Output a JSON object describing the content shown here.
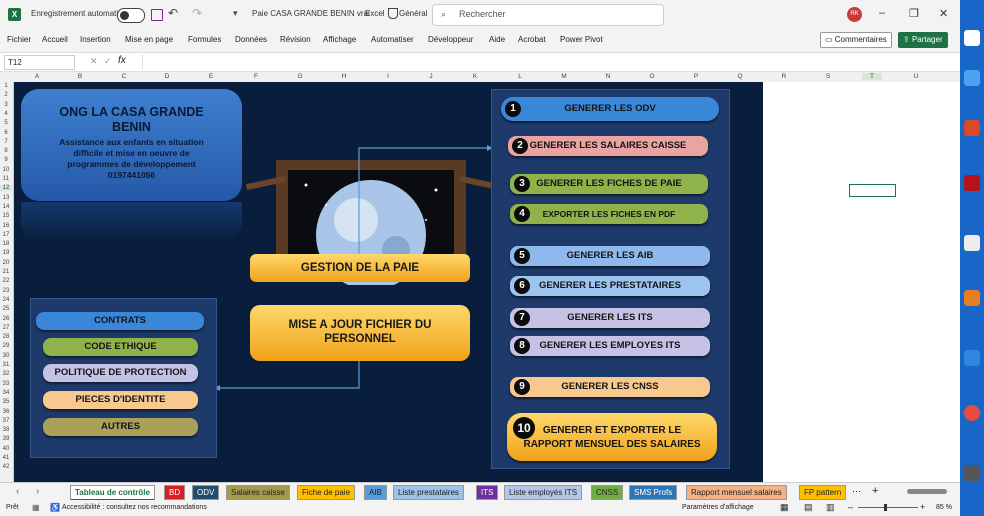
{
  "titlebar": {
    "autosave_label": "Enregistrement automatique",
    "doc_title": "Paie CASA GRANDE BENIN vrai",
    "app_name": "Excel",
    "sensitivity": "Général",
    "search_placeholder": "Rechercher",
    "avatar_initials": "RK"
  },
  "menu": [
    "Fichier",
    "Accueil",
    "Insertion",
    "Mise en page",
    "Formules",
    "Données",
    "Révision",
    "Affichage",
    "Automatiser",
    "Développeur",
    "Aide",
    "Acrobat",
    "Power Pivot"
  ],
  "comments_label": "Commentaires",
  "share_label": "Partager",
  "formula_bar": {
    "name_box": "T12",
    "fx": "fx"
  },
  "columns": [
    "A",
    "B",
    "C",
    "D",
    "E",
    "F",
    "G",
    "H",
    "I",
    "J",
    "K",
    "L",
    "M",
    "N",
    "O",
    "P",
    "Q",
    "R",
    "S",
    "T",
    "U"
  ],
  "rows": [
    "1",
    "2",
    "3",
    "4",
    "5",
    "6",
    "7",
    "8",
    "9",
    "10",
    "11",
    "12",
    "13",
    "14",
    "15",
    "16",
    "17",
    "18",
    "19",
    "20",
    "21",
    "22",
    "23",
    "24",
    "25",
    "26",
    "27",
    "28",
    "29",
    "30",
    "31",
    "32",
    "33",
    "34",
    "35",
    "36",
    "37",
    "38",
    "39",
    "40",
    "41",
    "42"
  ],
  "dashboard": {
    "org_name_1": "ONG LA CASA GRANDE",
    "org_name_2": "BENIN",
    "org_desc_1": "Assistance aux enfants en situation",
    "org_desc_2": "difficile et mise en oeuvre de",
    "org_desc_3": "programmes de développement",
    "org_phone": "0197441056",
    "gestion": "GESTION DE LA PAIE",
    "mise_a_jour_1": "MISE A JOUR FICHIER DU",
    "mise_a_jour_2": "PERSONNEL",
    "left_buttons": [
      {
        "label": "CONTRATS",
        "color": "#3a86d8"
      },
      {
        "label": "CODE ETHIQUE",
        "color": "#8fb34a"
      },
      {
        "label": "POLITIQUE DE PROTECTION",
        "color": "#c6c2e6"
      },
      {
        "label": "PIECES D'IDENTITE",
        "color": "#f7c98f"
      },
      {
        "label": "AUTRES",
        "color": "#a9a15a"
      }
    ],
    "right_buttons": [
      {
        "num": "1",
        "label": "GENERER LES ODV",
        "color": "#3a86d8"
      },
      {
        "num": "2",
        "label": "GENERER LES SALAIRES CAISSE",
        "color": "#e9a3a0"
      },
      {
        "num": "3",
        "label": "GENERER LES FICHES DE PAIE",
        "color": "#8fb34a"
      },
      {
        "num": "4",
        "label": "EXPORTER LES FICHES EN PDF",
        "color": "#8fb34a"
      },
      {
        "num": "5",
        "label": "GENERER LES AIB",
        "color": "#8fb8ec"
      },
      {
        "num": "6",
        "label": "GENERER LES PRESTATAIRES",
        "color": "#9cc4ef"
      },
      {
        "num": "7",
        "label": "GENERER LES ITS",
        "color": "#c6c2e6"
      },
      {
        "num": "8",
        "label": "GENERER LES EMPLOYES ITS",
        "color": "#c6c2e6"
      },
      {
        "num": "9",
        "label": "GENERER LES CNSS",
        "color": "#f7c98f"
      }
    ],
    "big_button": {
      "num": "10",
      "label_1": "GENERER ET EXPORTER LE",
      "label_2": "RAPPORT MENSUEL DES SALAIRES"
    }
  },
  "sheet_tabs": [
    {
      "label": "Tableau de contrôle",
      "color": "#ffffff"
    },
    {
      "label": "BD",
      "color": "#d42020"
    },
    {
      "label": "ODV",
      "color": "#1f4e6e"
    },
    {
      "label": "Salaires caisse",
      "color": "#a39a4e"
    },
    {
      "label": "Fiche de paie",
      "color": "#ffc000"
    },
    {
      "label": "AIB",
      "color": "#5b9bd5"
    },
    {
      "label": "Liste prestataires",
      "color": "#9dc3e6"
    },
    {
      "label": "ITS",
      "color": "#7030a0"
    },
    {
      "label": "Liste employés ITS",
      "color": "#b4c7e7"
    },
    {
      "label": "CNSS",
      "color": "#70ad47"
    },
    {
      "label": "SMS Profs",
      "color": "#2f75b5"
    },
    {
      "label": "Rapport mensuel salaires",
      "color": "#f4b183"
    },
    {
      "label": "FP pattern",
      "color": "#ffc000"
    }
  ],
  "status": {
    "ready": "Prêt",
    "accessibility": "Accessibilité : consultez nos recommandations",
    "display_settings": "Paramètres d'affichage",
    "zoom": "85 %"
  }
}
